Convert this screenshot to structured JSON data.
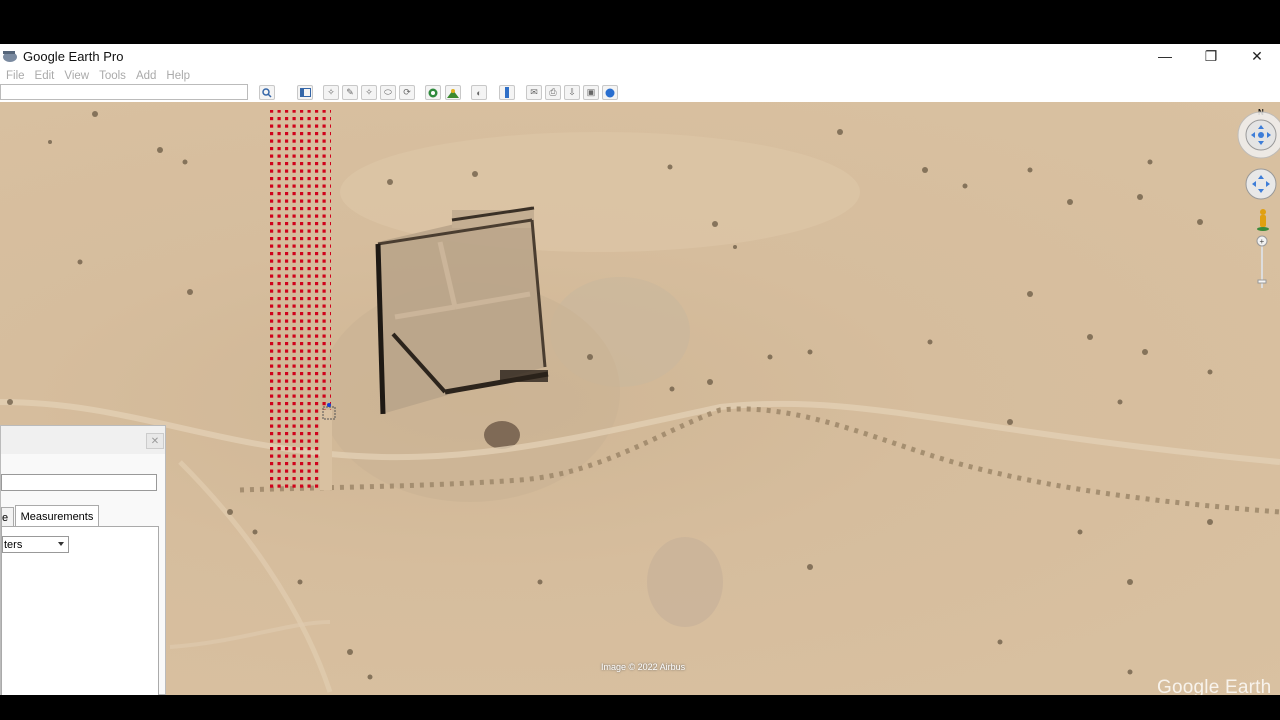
{
  "window": {
    "title": "Google Earth Pro",
    "controls": {
      "minimize": "—",
      "restore": "❐",
      "close": "✕"
    }
  },
  "menu": [
    {
      "label": "File"
    },
    {
      "label": "Edit"
    },
    {
      "label": "View"
    },
    {
      "label": "Tools"
    },
    {
      "label": "Add"
    },
    {
      "label": "Help"
    }
  ],
  "toolbar": {
    "search_value": "",
    "icons": [
      "search-icon",
      "sidebar-toggle-icon",
      "placemark-icon",
      "polygon-icon",
      "path-icon",
      "image-overlay-icon",
      "record-tour-icon",
      "historical-imagery-icon",
      "sun-icon",
      "planets-icon",
      "ruler-icon",
      "email-icon",
      "print-icon",
      "save-image-icon",
      "view-in-maps-icon",
      "earth-gallery-icon"
    ]
  },
  "map": {
    "imagery_credit": "Image © 2022 Airbus",
    "watermark": "Google Earth",
    "compass_label": "N"
  },
  "ruler_panel": {
    "tabs": [
      {
        "label": "e"
      },
      {
        "label": "Measurements"
      }
    ],
    "units_value": "ters",
    "close_label": "✕"
  },
  "colors": {
    "terrain": "#d6bd9d",
    "grid_red": "#d0021b",
    "nav_blue": "#3d7dd8"
  }
}
